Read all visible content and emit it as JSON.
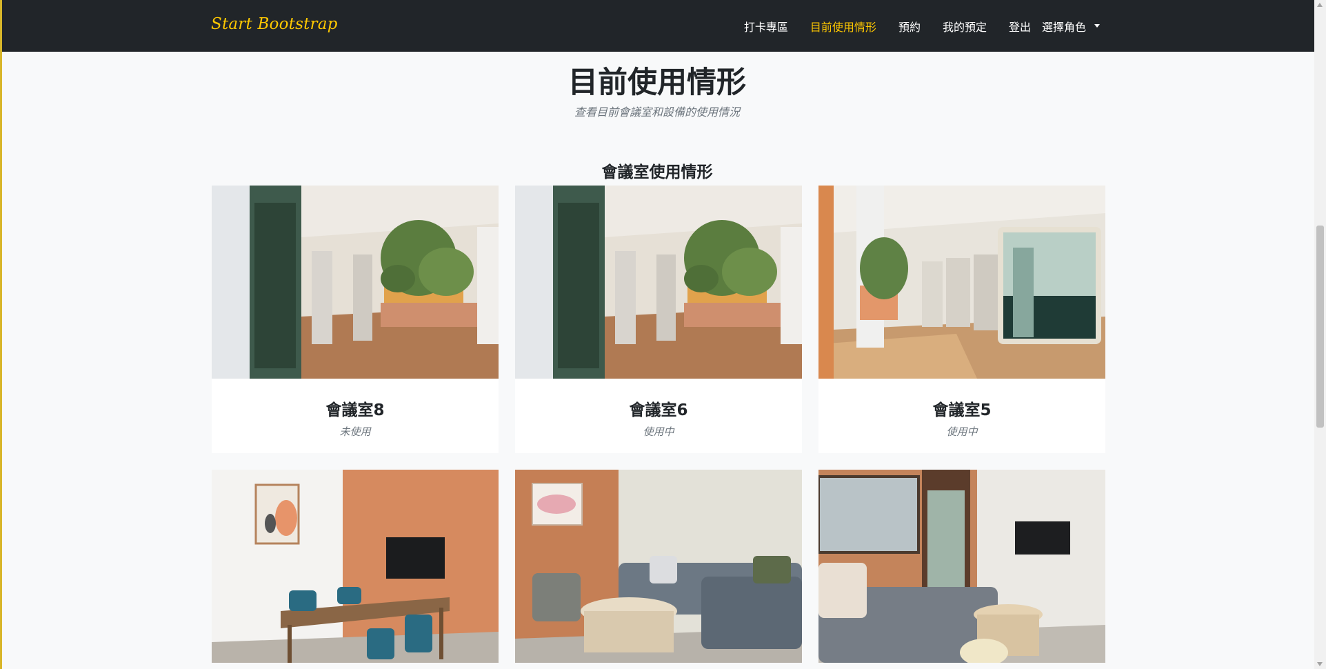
{
  "navbar": {
    "brand": "Start Bootstrap",
    "links": [
      {
        "label": "打卡專區",
        "active": false
      },
      {
        "label": "目前使用情形",
        "active": true
      },
      {
        "label": "預約",
        "active": false
      },
      {
        "label": "我的預定",
        "active": false
      },
      {
        "label": "登出",
        "active": false
      }
    ],
    "dropdown_label": "選擇角色"
  },
  "header": {
    "title": "目前使用情形",
    "subtitle": "查看目前會議室和設備的使用情況"
  },
  "section": {
    "title": "會議室使用情形"
  },
  "rooms": [
    {
      "name": "會議室8",
      "status": "未使用"
    },
    {
      "name": "會議室6",
      "status": "使用中"
    },
    {
      "name": "會議室5",
      "status": "使用中"
    },
    {
      "name": "",
      "status": ""
    },
    {
      "name": "",
      "status": ""
    },
    {
      "name": "",
      "status": ""
    }
  ],
  "colors": {
    "navbar_bg": "#212529",
    "accent": "#ffc800",
    "page_bg": "#f8f9fa",
    "muted_text": "#6c757d"
  }
}
